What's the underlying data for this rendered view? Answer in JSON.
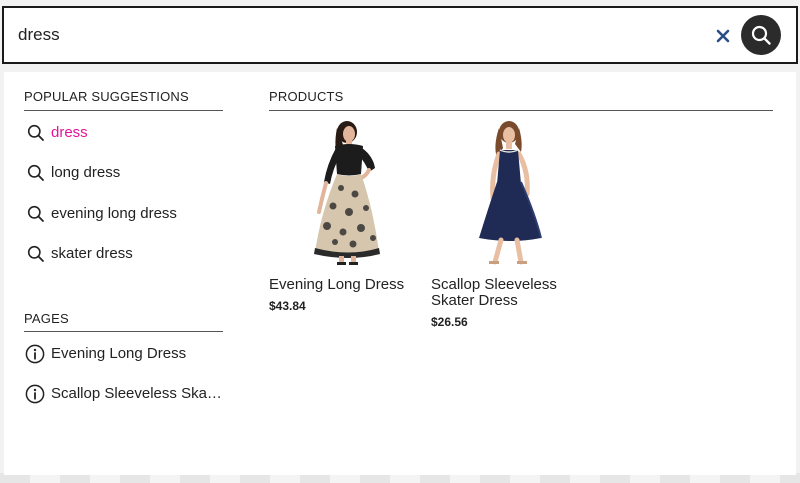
{
  "search": {
    "value": "dress",
    "clear_icon": "close-icon",
    "submit_icon": "search-icon"
  },
  "suggestions": {
    "heading": "POPULAR SUGGESTIONS",
    "items": [
      {
        "label": "dress",
        "highlight": true
      },
      {
        "label": "long dress",
        "highlight": false
      },
      {
        "label": "evening long dress",
        "highlight": false
      },
      {
        "label": "skater dress",
        "highlight": false
      }
    ]
  },
  "pages": {
    "heading": "PAGES",
    "items": [
      {
        "label": "Evening Long Dress",
        "icon": "info-icon"
      },
      {
        "label": "Scallop Sleeveless Skater Dress",
        "icon": "info-icon"
      }
    ]
  },
  "products": {
    "heading": "PRODUCTS",
    "items": [
      {
        "name": "Evening Long Dress",
        "price": "$43.84"
      },
      {
        "name": "Scallop Sleeveless Skater Dress",
        "price": "$26.56"
      }
    ]
  },
  "colors": {
    "highlight": "#e0169a",
    "clear_icon": "#2a4f86",
    "submit_bg": "#2b2b2b"
  }
}
